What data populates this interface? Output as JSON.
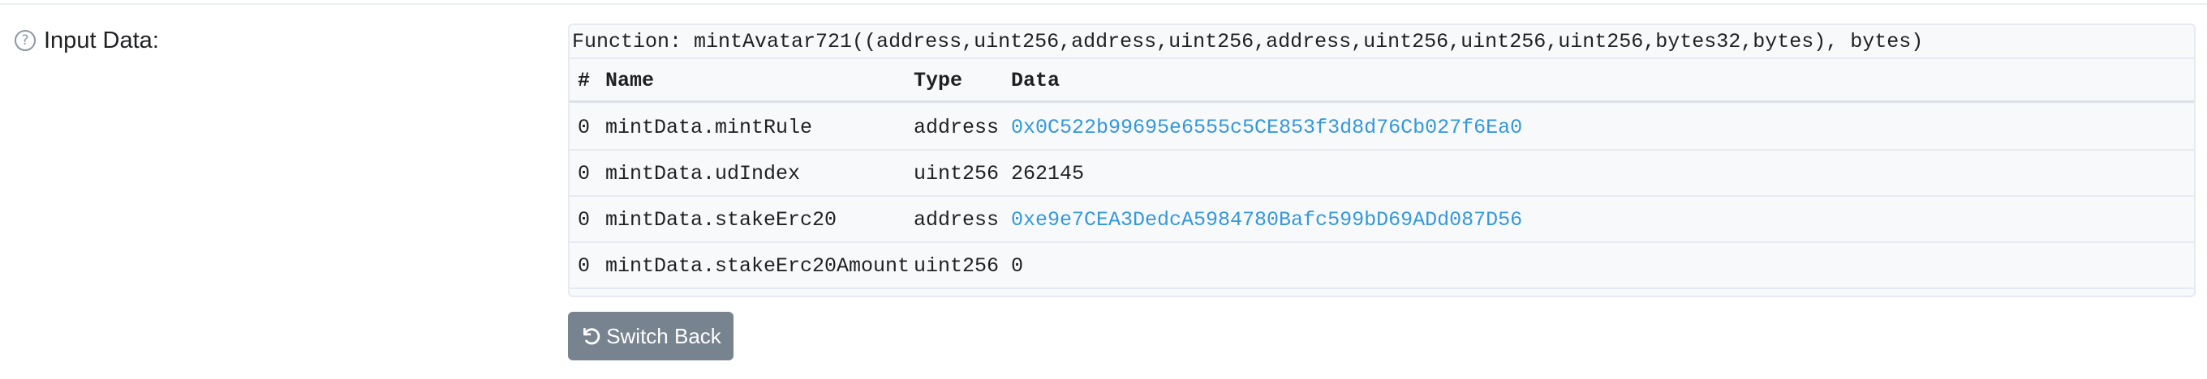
{
  "section": {
    "label": "Input Data:",
    "help_icon": "question-circle-icon"
  },
  "decoded": {
    "function_signature": "Function: mintAvatar721((address,uint256,address,uint256,address,uint256,uint256,uint256,bytes32,bytes), bytes)",
    "columns": {
      "index": "#",
      "name": "Name",
      "type": "Type",
      "data": "Data"
    },
    "rows": [
      {
        "index": "0",
        "name": "mintData.mintRule",
        "type": "address",
        "data": "0x0C522b99695e6555c5CE853f3d8d76Cb027f6Ea0",
        "is_link": true
      },
      {
        "index": "0",
        "name": "mintData.udIndex",
        "type": "uint256",
        "data": "262145",
        "is_link": false
      },
      {
        "index": "0",
        "name": "mintData.stakeErc20",
        "type": "address",
        "data": "0xe9e7CEA3DedcA5984780Bafc599bD69ADd087D56",
        "is_link": true
      },
      {
        "index": "0",
        "name": "mintData.stakeErc20Amount",
        "type": "uint256",
        "data": "0",
        "is_link": false
      }
    ]
  },
  "actions": {
    "switch_back_label": "Switch Back",
    "switch_back_icon": "undo-icon"
  },
  "colors": {
    "link": "#3498db",
    "button_bg": "#77838f",
    "panel_bg": "#f8f9fa",
    "border": "#e7eaf3"
  }
}
